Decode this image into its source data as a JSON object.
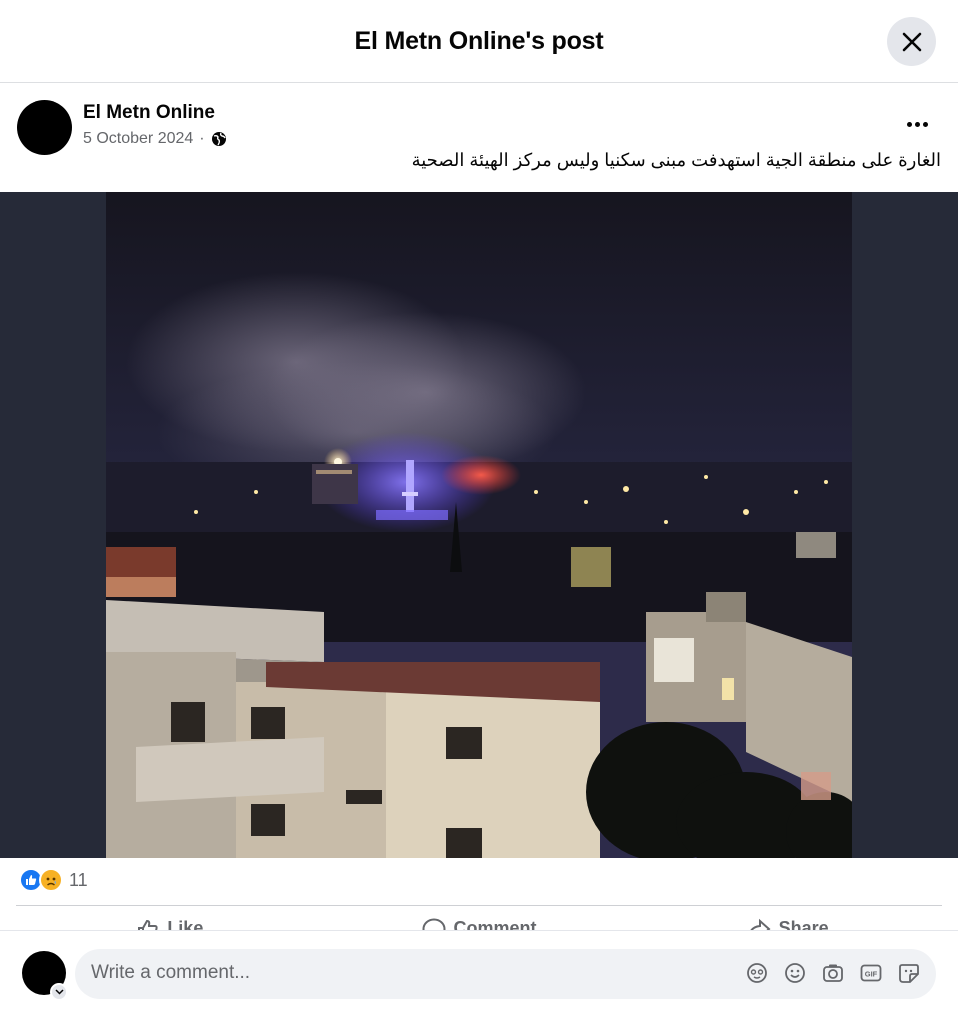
{
  "dialog": {
    "title": "El Metn Online's post"
  },
  "post": {
    "author": "El Metn Online",
    "date": "5 October 2024",
    "separator": "·",
    "privacy_icon": "globe-icon",
    "caption": "الغارة على منطقة الجية استهدفت مبنى سكنيا وليس مركز الهيئة الصحية"
  },
  "reactions": {
    "types": [
      "like",
      "sad"
    ],
    "count": "11"
  },
  "actions": [
    {
      "label": "Like",
      "icon": "thumbs-up-icon"
    },
    {
      "label": "Comment",
      "icon": "comment-icon"
    },
    {
      "label": "Share",
      "icon": "share-icon"
    }
  ],
  "comment": {
    "placeholder": "Write a comment...",
    "tools": [
      "avatar-sticker-icon",
      "emoji-icon",
      "camera-icon",
      "gif-icon",
      "sticker-icon"
    ]
  },
  "colors": {
    "accent": "#1877f2",
    "sad": "#f7b125",
    "media_bg": "#262a38"
  }
}
